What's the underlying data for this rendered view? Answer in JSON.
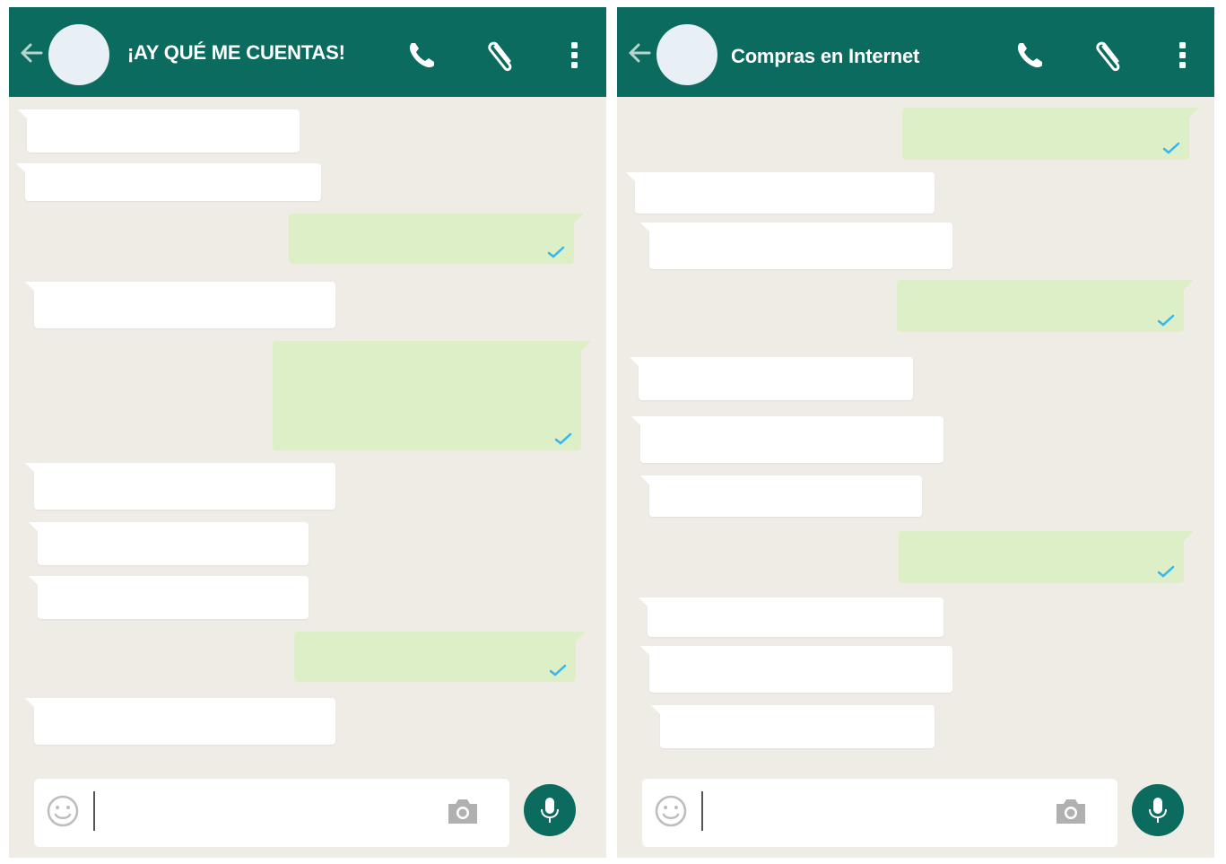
{
  "colors": {
    "header": "#0b6b5f",
    "background": "#efece6",
    "incoming_bubble": "#ffffff",
    "outgoing_bubble": "#dcefc6",
    "read_tick": "#34b7f1",
    "mic_button": "#0b6b5f"
  },
  "icons": [
    "back-arrow-icon",
    "avatar",
    "phone-call-icon",
    "paperclip-icon",
    "more-vertical-icon",
    "read-tick-icon",
    "smiley-icon",
    "camera-icon",
    "microphone-icon"
  ],
  "chats": [
    {
      "title": "¡AY QUÉ ME CUENTAS!",
      "messages": [
        "in",
        "in",
        "out",
        "in",
        "out",
        "in",
        "in",
        "in",
        "out",
        "in"
      ],
      "input_value": ""
    },
    {
      "title": "Compras en Internet",
      "messages": [
        "out",
        "in",
        "in",
        "out",
        "in",
        "in",
        "in",
        "out",
        "in",
        "in",
        "in"
      ],
      "input_value": ""
    }
  ]
}
